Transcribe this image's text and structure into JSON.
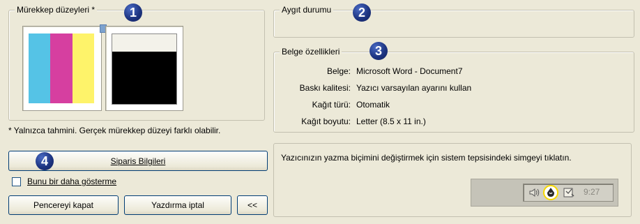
{
  "ink_levels": {
    "title": "Mürekkep düzeyleri *",
    "badge": "1",
    "color_cartridge": {
      "segments": [
        {
          "color": "#55c3e6",
          "name": "cyan"
        },
        {
          "color": "#d63fa0",
          "name": "magenta"
        },
        {
          "color": "#fef36a",
          "name": "yellow"
        }
      ]
    },
    "black_cartridge": {
      "ink_color": "#000000",
      "ink_level": 0.75
    },
    "footnote": "* Yalnızca tahmini. Gerçek mürekkep düzeyi farklı olabilir."
  },
  "device_status": {
    "title": "Aygıt durumu",
    "badge": "2",
    "text": ""
  },
  "document_properties": {
    "title": "Belge özellikleri",
    "badge": "3",
    "rows": [
      {
        "label": "Belge:",
        "value": "Microsoft Word - Document7"
      },
      {
        "label": "Baskı kalitesi:",
        "value": "Yazıcı varsayılan ayarını kullan"
      },
      {
        "label": "Kağıt türü:",
        "value": "Otomatik"
      },
      {
        "label": "Kağıt boyutu:",
        "value": "Letter (8.5 x 11 in.)"
      }
    ]
  },
  "order_button": {
    "label": "Siparis Bilgileri",
    "badge": "4"
  },
  "dont_show_checkbox": {
    "label": "Bunu bir daha gösterme",
    "checked": false
  },
  "buttons": {
    "close_window": "Pencereyi kapat",
    "cancel_print": "Yazdırma iptal",
    "collapse": "<<"
  },
  "tray_hint": {
    "text": "Yazıcınızın yazma biçimini değiştirmek için sistem tepsisindeki simgeyi tıklatın.",
    "tray_icons": [
      "speaker-icon",
      "printer-status-icon",
      "tray-app-icon"
    ],
    "clock": "9:27"
  },
  "colors": {
    "window_bg": "#ece9d8",
    "badge": "#1e3582",
    "highlight_ring": "#f7d800"
  }
}
